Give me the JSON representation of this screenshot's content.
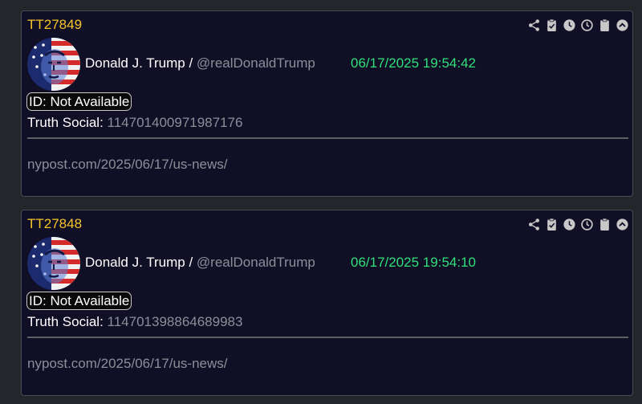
{
  "colors": {
    "background": "#23262b",
    "card_background": "#110f26",
    "id_accent": "#f6c42a",
    "timestamp_green": "#2fe07a",
    "muted_text": "#8e8e98"
  },
  "actions": [
    {
      "icon": "share-icon"
    },
    {
      "icon": "clipboard-check-icon"
    },
    {
      "icon": "clock-solid-icon"
    },
    {
      "icon": "clock-outline-icon"
    },
    {
      "icon": "clipboard-icon"
    },
    {
      "icon": "chevron-up-circle-icon"
    }
  ],
  "posts": [
    {
      "tt_id": "TT27849",
      "author_name": "Donald J. Trump",
      "separator": " / ",
      "handle": "@realDonaldTrump",
      "timestamp": "06/17/2025 19:54:42",
      "id_badge": "ID: Not Available",
      "truth_label": "Truth Social:",
      "truth_id": "114701400971987176",
      "link": "nypost.com/2025/06/17/us-news/"
    },
    {
      "tt_id": "TT27848",
      "author_name": "Donald J. Trump",
      "separator": " / ",
      "handle": "@realDonaldTrump",
      "timestamp": "06/17/2025 19:54:10",
      "id_badge": "ID: Not Available",
      "truth_label": "Truth Social:",
      "truth_id": "114701398864689983",
      "link": "nypost.com/2025/06/17/us-news/"
    }
  ]
}
